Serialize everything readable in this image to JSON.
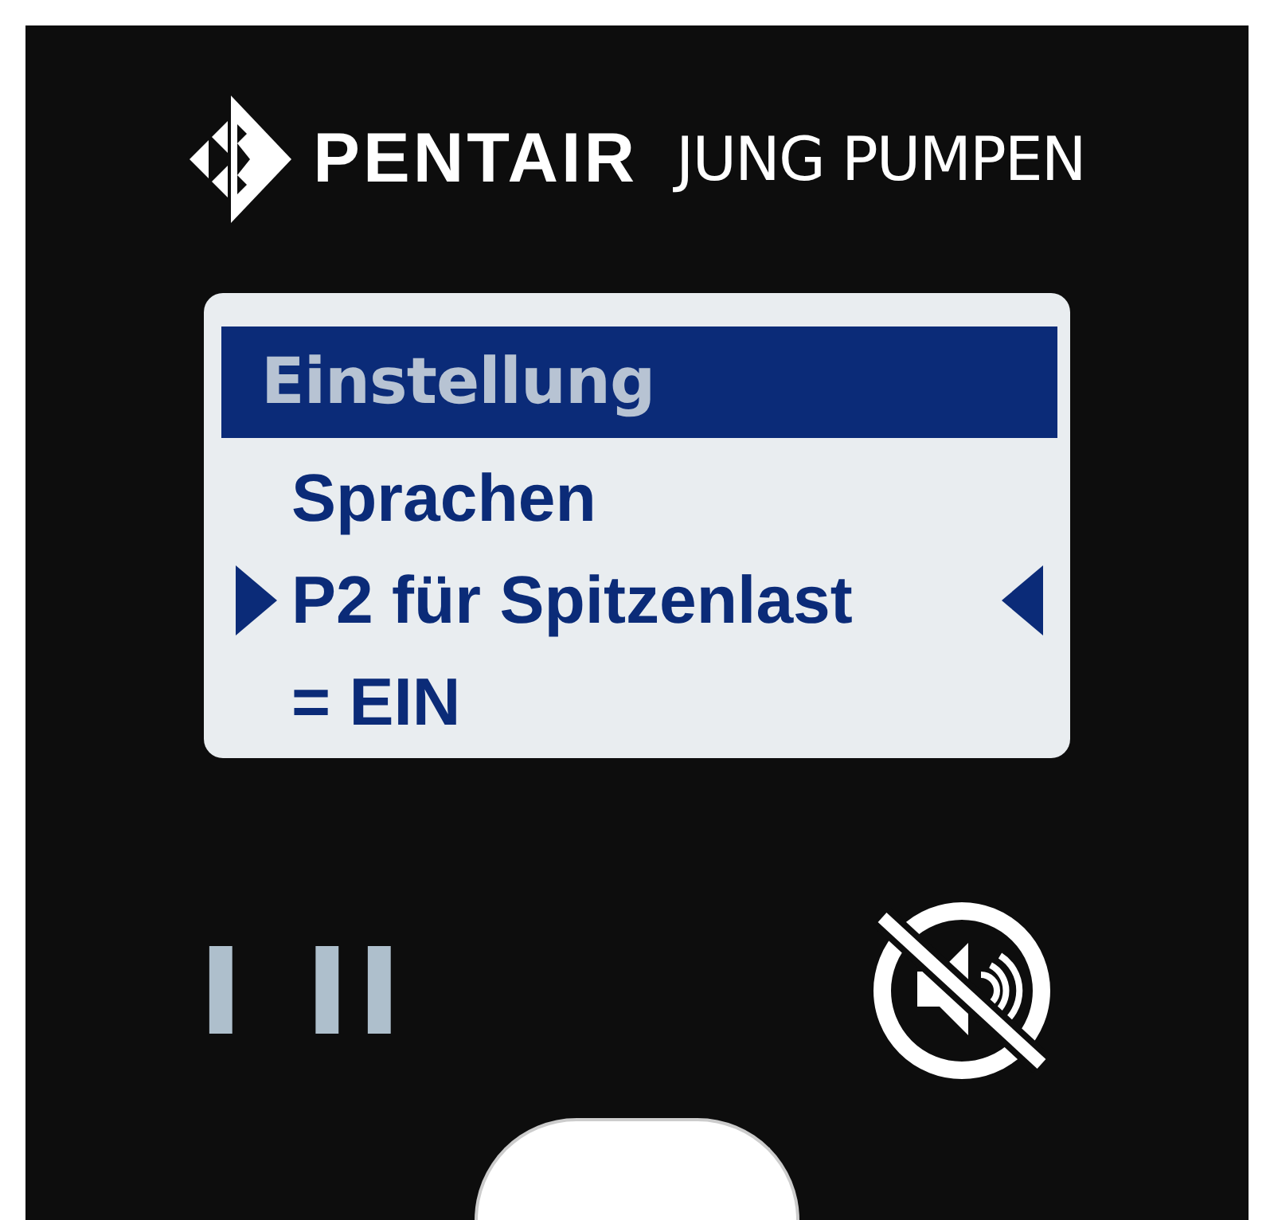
{
  "brand": {
    "name": "PENTAIR",
    "subname": "JUNG PUMPEN"
  },
  "display": {
    "title": "Einstellung",
    "lines": [
      {
        "text": "Sprachen",
        "selected": false
      },
      {
        "text": "P2 für Spitzenlast",
        "selected": true
      },
      {
        "text": "= EIN",
        "selected": false
      }
    ]
  },
  "pumps": [
    {
      "label": "I"
    },
    {
      "label": "II"
    }
  ],
  "alarm": {
    "muted": true
  }
}
